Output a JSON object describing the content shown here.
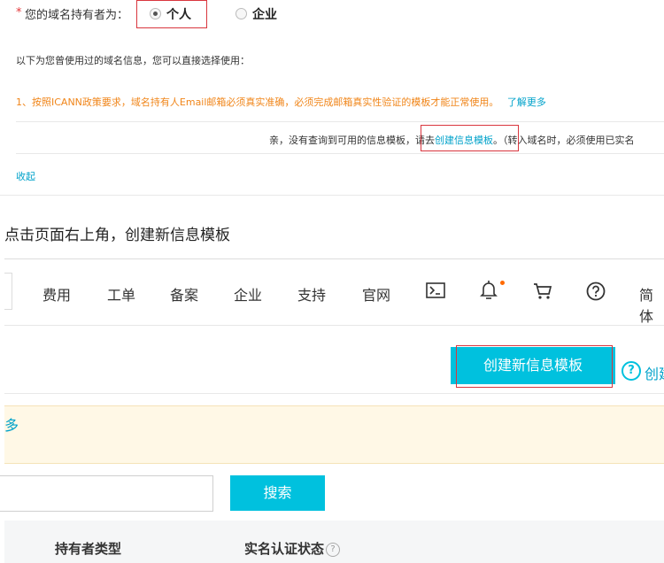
{
  "form": {
    "required_mark": "*",
    "owner_label": "您的域名持有者为：",
    "options": [
      {
        "label": "个人",
        "checked": true
      },
      {
        "label": "企业",
        "checked": false
      }
    ]
  },
  "info": {
    "used_templates_text": "以下为您曾使用过的域名信息，您可以直接选择使用：",
    "policy_notice": "1、按照ICANN政策要求，域名持有人Email邮箱必须真实准确，必须完成邮箱真实性验证的模板才能正常使用。",
    "learn_more": "了解更多",
    "no_template_prefix": "亲，没有查询到可用的信息模板，",
    "no_template_go": "请去",
    "create_template_link": "创建信息模板",
    "no_template_suffix": "。（转入域名时，必须使用已实名",
    "collapse": "收起"
  },
  "caption": "点击页面右上角，创建新信息模板",
  "console_nav": {
    "items": [
      "费用",
      "工单",
      "备案",
      "企业",
      "支持",
      "官网"
    ],
    "lang": "简体",
    "icons": [
      "terminal-icon",
      "bell-icon",
      "cart-icon",
      "help-icon"
    ]
  },
  "actions": {
    "create_button": "创建新信息模板",
    "help_glyph": "?",
    "help_text_partial": "创建"
  },
  "notice": {
    "text_partial": "多"
  },
  "search": {
    "button": "搜索"
  },
  "table": {
    "headers": [
      "持有者类型",
      "实名认证状态"
    ]
  },
  "colors": {
    "accent": "#00c1de",
    "link": "#00a2ca",
    "warning": "#f08519",
    "highlight_box": "#d9363e"
  }
}
